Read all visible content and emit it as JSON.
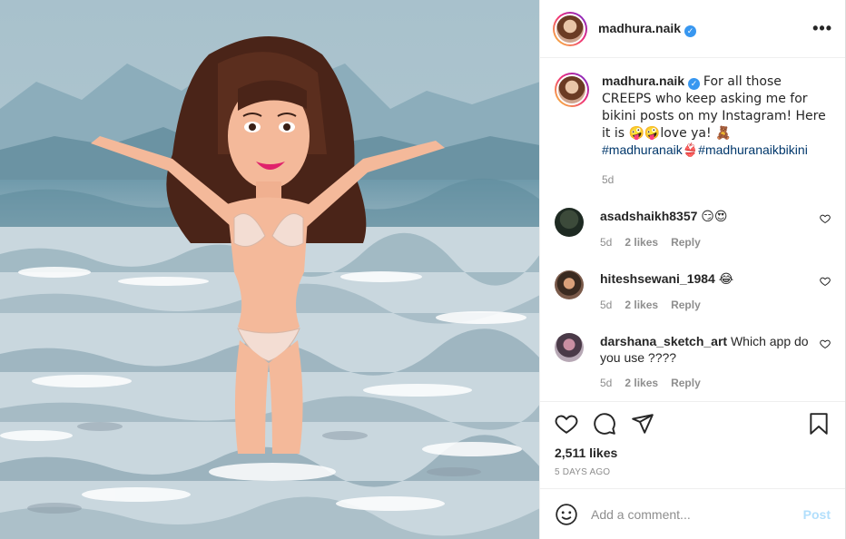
{
  "post": {
    "username": "madhura.naik",
    "verified_mark": "✓",
    "more_label": "•••",
    "caption": {
      "username": "madhura.naik",
      "text_main": "For all those CREEPS who keep asking me for bikini posts on my Instagram! Here it is 🤪🤪love ya! 🧸",
      "hashtag1": "#madhuranaik",
      "hashtag_emoji": "👙",
      "hashtag2": "#madhuranaikbikini",
      "time": "5d"
    },
    "comments": [
      {
        "username": "asadshaikh8357",
        "text": "😏😍",
        "time": "5d",
        "likes": "2 likes",
        "reply": "Reply"
      },
      {
        "username": "hiteshsewani_1984",
        "text": "😂",
        "time": "5d",
        "likes": "2 likes",
        "reply": "Reply"
      },
      {
        "username": "darshana_sketch_art",
        "text": "Which app do you use ????",
        "time": "5d",
        "likes": "2 likes",
        "reply": "Reply"
      }
    ],
    "likes_count": "2,511 likes",
    "posted_ago": "5 DAYS AGO",
    "add_comment_placeholder": "Add a comment...",
    "post_button": "Post"
  },
  "icons": {
    "like": "heart-icon",
    "comment": "comment-bubble-icon",
    "share": "paper-plane-icon",
    "save": "bookmark-icon",
    "emoji": "smiley-icon"
  },
  "colors": {
    "link": "#00376b",
    "verified": "#3897f0",
    "muted": "#8e8e8e",
    "post_disabled": "#b2dffc"
  }
}
